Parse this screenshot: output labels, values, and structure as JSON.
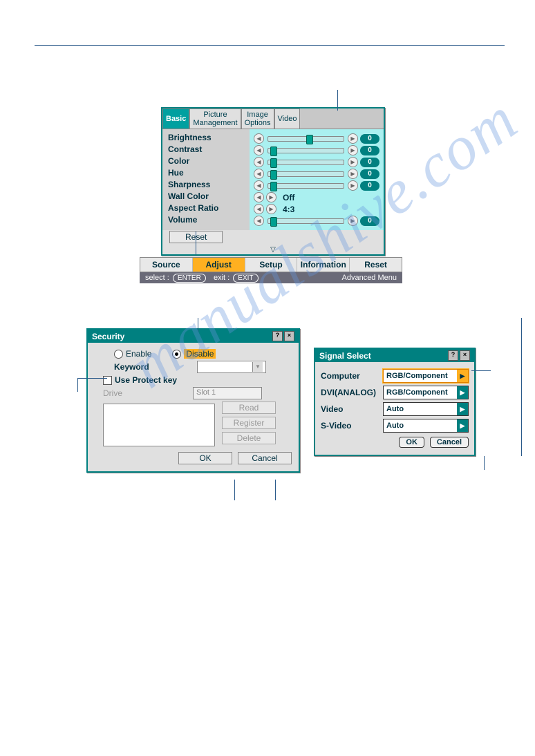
{
  "adjust": {
    "tabs": [
      "Basic",
      "Picture\nManagement",
      "Image\nOptions",
      "Video"
    ],
    "rows": {
      "brightness": {
        "label": "Brightness",
        "value": "0"
      },
      "contrast": {
        "label": "Contrast",
        "value": "0"
      },
      "color": {
        "label": "Color",
        "value": "0"
      },
      "hue": {
        "label": "Hue",
        "value": "0"
      },
      "sharpness": {
        "label": "Sharpness",
        "value": "0"
      },
      "wallcolor": {
        "label": "Wall Color",
        "value": "Off"
      },
      "aspect": {
        "label": "Aspect Ratio",
        "value": "4:3"
      },
      "volume": {
        "label": "Volume",
        "value": "0"
      }
    },
    "reset": "Reset"
  },
  "menubar": {
    "items": [
      "Source",
      "Adjust",
      "Setup",
      "Information",
      "Reset"
    ],
    "select": "select :",
    "enter": "ENTER",
    "exit": "exit :",
    "exitbtn": "EXIT",
    "advanced": "Advanced Menu"
  },
  "security": {
    "title": "Security",
    "enable": "Enable",
    "disable": "Disable",
    "keyword": "Keyword",
    "use_protect": "Use Protect key",
    "drive": "Drive",
    "slot": "Slot 1",
    "read": "Read",
    "register": "Register",
    "delete": "Delete",
    "ok": "OK",
    "cancel": "Cancel"
  },
  "signal": {
    "title": "Signal Select",
    "rows": {
      "computer": {
        "label": "Computer",
        "value": "RGB/Component"
      },
      "dvi": {
        "label": "DVI(ANALOG)",
        "value": "RGB/Component"
      },
      "video": {
        "label": "Video",
        "value": "Auto"
      },
      "svideo": {
        "label": "S-Video",
        "value": "Auto"
      }
    },
    "ok": "OK",
    "cancel": "Cancel"
  }
}
